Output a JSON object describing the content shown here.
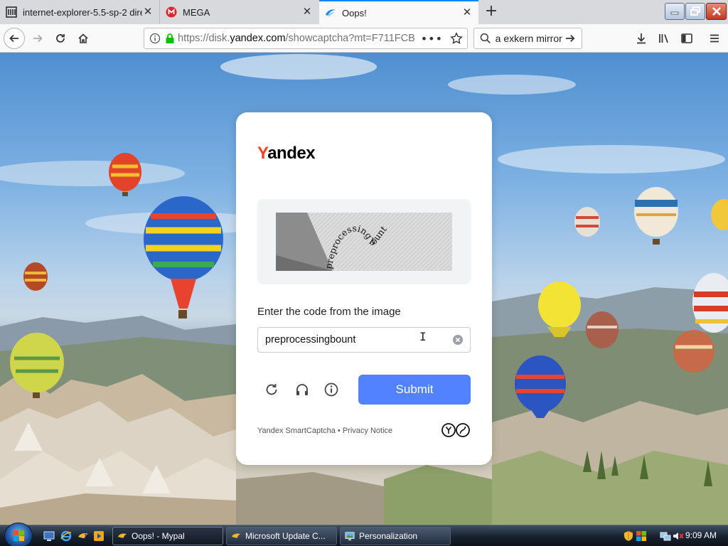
{
  "browser": {
    "tabs": [
      {
        "title": "internet-explorer-5.5-sp-2 direc",
        "icon": "archive-icon"
      },
      {
        "title": "MEGA",
        "icon": "mega-icon"
      },
      {
        "title": "Oops!",
        "icon": "yandex-disk-icon"
      }
    ],
    "url": {
      "prefix": "https://disk.",
      "domain": "yandex.com",
      "path": "/showcaptcha?mt=F711FCB"
    },
    "search_text": "a exkern mirror"
  },
  "captcha": {
    "logo_first": "Y",
    "logo_rest": "andex",
    "image_text": "preprocessing bount",
    "prompt": "Enter the code from the image",
    "input_value": "preprocessingbount",
    "submit_label": "Submit",
    "footer_product": "Yandex SmartCaptcha",
    "footer_sep": " • ",
    "footer_privacy": "Privacy Notice",
    "accent_color": "#5282ff"
  },
  "taskbar": {
    "tasks": [
      {
        "label": "Oops! - Mypal",
        "icon": "mypal-icon",
        "active": true
      },
      {
        "label": "Microsoft Update C...",
        "icon": "update-icon",
        "active": false
      },
      {
        "label": "Personalization",
        "icon": "personalization-icon",
        "active": false
      }
    ],
    "clock": "9:09 AM"
  }
}
